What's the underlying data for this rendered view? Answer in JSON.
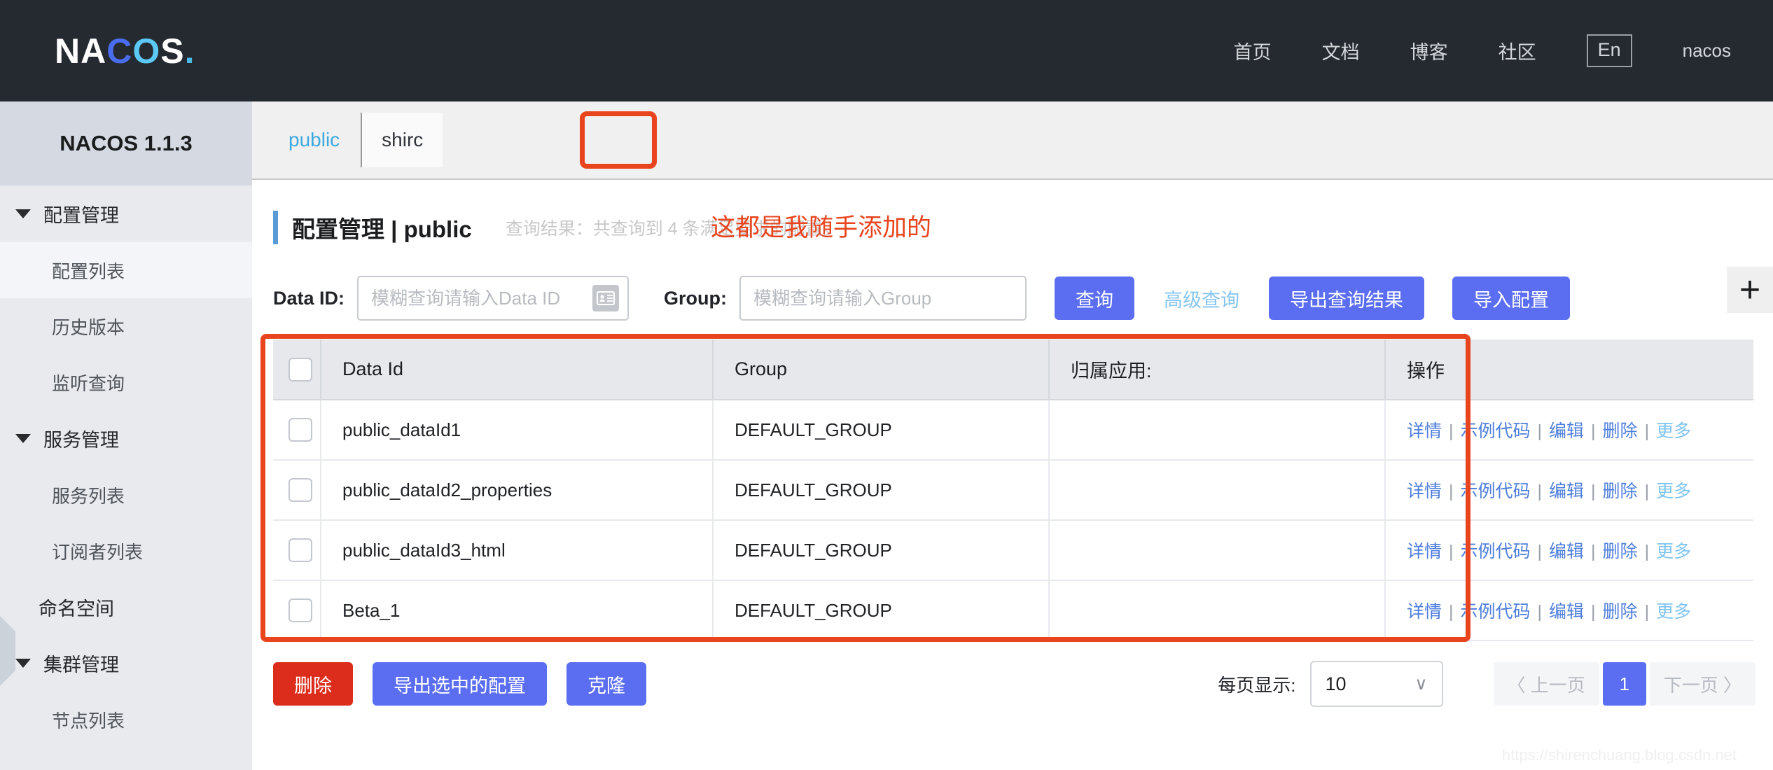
{
  "topnav": {
    "logo": {
      "part1": "NA",
      "part2": "C",
      "part3": "O",
      "part4": "S",
      "dot": "."
    },
    "items": [
      {
        "label": "首页",
        "name": "nav-home"
      },
      {
        "label": "文档",
        "name": "nav-docs"
      },
      {
        "label": "博客",
        "name": "nav-blog"
      },
      {
        "label": "社区",
        "name": "nav-community"
      }
    ],
    "lang_label": "En",
    "user": "nacos",
    "bg_color": "#252a30"
  },
  "sidebar": {
    "header": "NACOS 1.1.3",
    "groups": [
      {
        "label": "配置管理",
        "items": [
          {
            "label": "配置列表",
            "active": true
          },
          {
            "label": "历史版本",
            "active": false
          },
          {
            "label": "监听查询",
            "active": false
          }
        ]
      },
      {
        "label": "服务管理",
        "items": [
          {
            "label": "服务列表",
            "active": false
          },
          {
            "label": "订阅者列表",
            "active": false
          }
        ]
      }
    ],
    "plain_item": "命名空间",
    "group3": {
      "label": "集群管理",
      "items": [
        {
          "label": "节点列表",
          "active": false
        }
      ]
    }
  },
  "namespace": {
    "tabs": [
      {
        "label": "public",
        "selected": false
      },
      {
        "label": "shirc",
        "selected": true
      }
    ]
  },
  "header": {
    "title": "配置管理  |  public",
    "result_text": "查询结果：共查询到 4 条满足要求的配置。",
    "annotation": "这都是我随手添加的",
    "annotation_color": "#e8441d",
    "accent_color": "#5b9bd5"
  },
  "filter": {
    "dataid_label": "Data ID:",
    "dataid_value": "",
    "dataid_placeholder": "模糊查询请输入Data ID",
    "dataid_icon": "idcard-icon",
    "group_label": "Group:",
    "group_value": "",
    "group_placeholder": "模糊查询请输入Group",
    "query_button": "查询",
    "advanced_link": "高级查询",
    "export_button": "导出查询结果",
    "import_button": "导入配置",
    "add_button": "+",
    "primary_color": "#5b6ef2"
  },
  "table": {
    "columns": [
      "",
      "Data Id",
      "Group",
      "归属应用:",
      "操作"
    ],
    "rows": [
      {
        "dataid": "public_dataId1",
        "group": "DEFAULT_GROUP",
        "app": ""
      },
      {
        "dataid": "public_dataId2_properties",
        "group": "DEFAULT_GROUP",
        "app": ""
      },
      {
        "dataid": "public_dataId3_html",
        "group": "DEFAULT_GROUP",
        "app": ""
      },
      {
        "dataid": "Beta_1",
        "group": "DEFAULT_GROUP",
        "app": ""
      }
    ],
    "actions": [
      "详情",
      "示例代码",
      "编辑",
      "删除",
      "更多"
    ],
    "action_separator": "|"
  },
  "footer": {
    "delete_button": "删除",
    "export_selected_button": "导出选中的配置",
    "clone_button": "克隆",
    "delete_color": "#dc2c1c"
  },
  "pagination": {
    "per_page_label": "每页显示:",
    "per_page_value": "10",
    "chevron": "∨",
    "prev_label": "〈 上一页",
    "page_number": "1",
    "next_label": "下一页 〉"
  },
  "watermark": "https://shirenchuang.blog.csdn.net"
}
